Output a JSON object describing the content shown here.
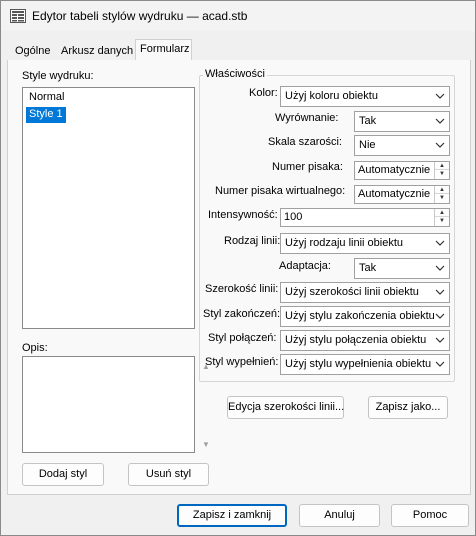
{
  "window": {
    "title": "Edytor tabeli stylów wydruku — acad.stb",
    "icon": "plot-style-editor-icon"
  },
  "tabs": [
    {
      "label": "Ogólne",
      "active": false
    },
    {
      "label": "Arkusz danych",
      "active": false
    },
    {
      "label": "Formularz",
      "active": true
    }
  ],
  "styles": {
    "label": "Style wydruku:",
    "items": [
      {
        "label": "Normal",
        "selected": false
      },
      {
        "label": "Style 1",
        "selected": true
      }
    ]
  },
  "description": {
    "label": "Opis:",
    "value": ""
  },
  "properties": {
    "group_title": "Właściwości",
    "color": {
      "label": "Kolor:",
      "value": "Użyj koloru obiektu"
    },
    "dither": {
      "label": "Wyrównanie:",
      "value": "Tak"
    },
    "grayscale": {
      "label": "Skala szarości:",
      "value": "Nie"
    },
    "pen_number": {
      "label": "Numer pisaka:",
      "value": "Automatycznie"
    },
    "virtual_pen": {
      "label": "Numer pisaka wirtualnego:",
      "value": "Automatycznie"
    },
    "intensity": {
      "label": "Intensywność:",
      "value": "100"
    },
    "linetype": {
      "label": "Rodzaj linii:",
      "value": "Użyj rodzaju linii obiektu"
    },
    "adaptive": {
      "label": "Adaptacja:",
      "value": "Tak"
    },
    "lineweight": {
      "label": "Szerokość linii:",
      "value": "Użyj szerokości linii obiektu"
    },
    "line_end": {
      "label": "Styl zakończeń:",
      "value": "Użyj stylu zakończenia obiektu"
    },
    "line_join": {
      "label": "Styl połączeń:",
      "value": "Użyj stylu połączenia obiektu"
    },
    "fill": {
      "label": "Styl wypełnień:",
      "value": "Użyj stylu wypełnienia obiektu"
    }
  },
  "buttons": {
    "edit_lineweights": "Edycja szerokości linii...",
    "save_as": "Zapisz jako...",
    "add_style": "Dodaj styl",
    "delete_style": "Usuń styl",
    "save_close": "Zapisz i zamknij",
    "cancel": "Anuluj",
    "help": "Pomoc"
  },
  "colors": {
    "selection": "#0078d7",
    "default_button_border": "#0067c0"
  }
}
